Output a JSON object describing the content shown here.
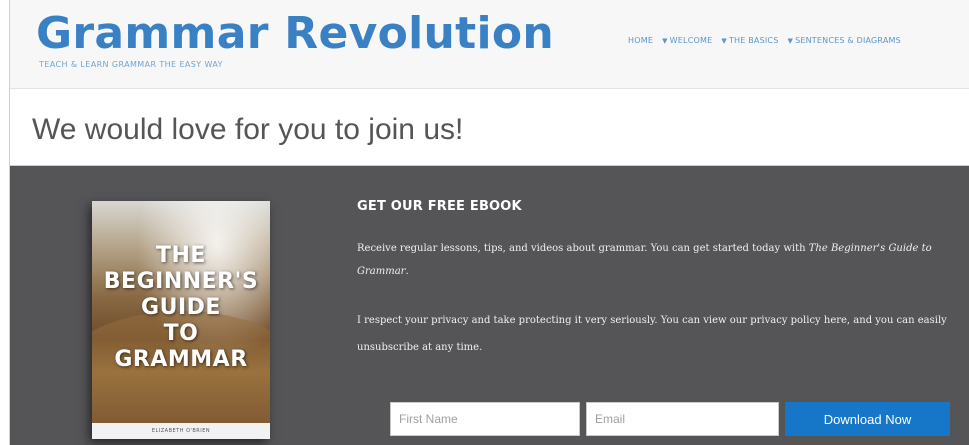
{
  "site": {
    "logo_title": "Grammar Revolution",
    "tagline": "TEACH & LEARN GRAMMAR THE EASY WAY"
  },
  "nav": {
    "items": [
      {
        "label": "HOME",
        "has_caret": false
      },
      {
        "label": "WELCOME",
        "has_caret": true
      },
      {
        "label": "THE BASICS",
        "has_caret": true
      },
      {
        "label": "SENTENCES & DIAGRAMS",
        "has_caret": true
      }
    ]
  },
  "join": {
    "heading": "We would love for you to join us!"
  },
  "ebook": {
    "heading": "GET OUR FREE EBOOK",
    "paragraph1_prefix": "Receive regular lessons, tips, and videos about grammar. You can get started today with ",
    "paragraph1_title": "The Beginner's Guide to Grammar",
    "paragraph1_suffix": ".",
    "paragraph2": "I respect your privacy and take protecting it very seriously. You can view our privacy policy here, and you can easily unsubscribe at any time."
  },
  "book": {
    "title_lines": [
      "THE",
      "BEGINNER'S",
      "GUIDE",
      "TO",
      "GRAMMAR"
    ],
    "author": "ELIZABETH O'BRIEN"
  },
  "form": {
    "first_name_placeholder": "First Name",
    "first_name_value": "",
    "email_placeholder": "Email",
    "email_value": "",
    "submit_label": "Download Now"
  },
  "colors": {
    "brand_blue": "#3a80c4",
    "panel_gray": "#555558",
    "button_blue": "#1677c8"
  }
}
